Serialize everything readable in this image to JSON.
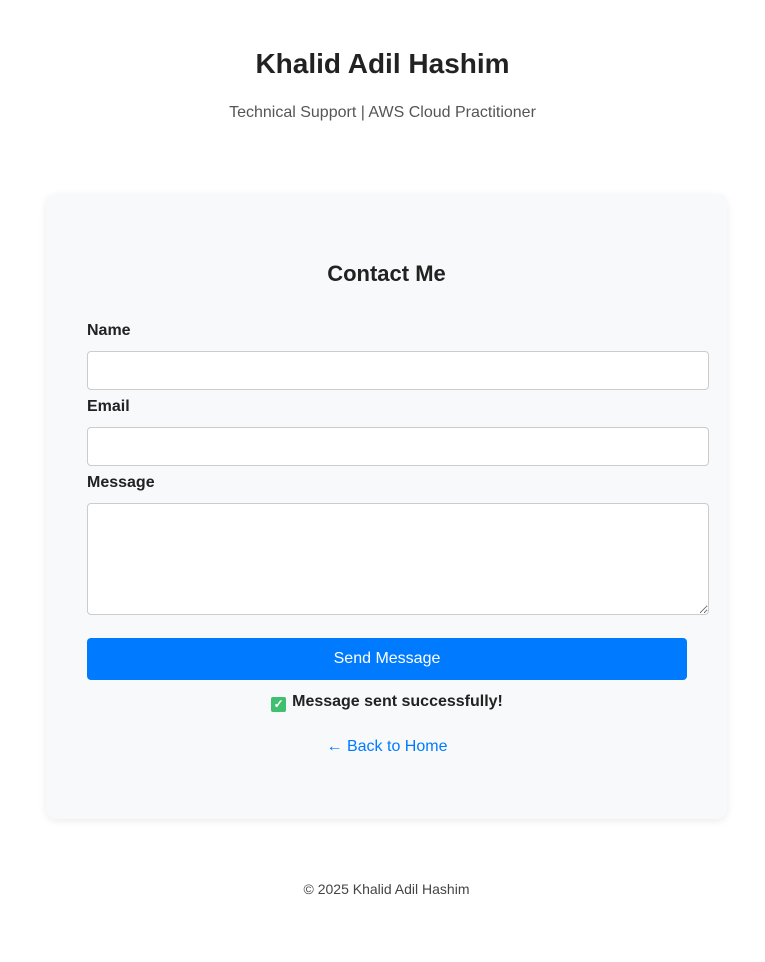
{
  "header": {
    "title": "Khalid Adil Hashim",
    "subtitle": "Technical Support | AWS Cloud Practitioner"
  },
  "contact": {
    "title": "Contact Me",
    "name_label": "Name",
    "name_value": "",
    "email_label": "Email",
    "email_value": "",
    "message_label": "Message",
    "message_value": "",
    "submit_label": "Send Message",
    "status_icon": "check-mark-button-icon",
    "status_text": "Message sent successfully!",
    "back_link": "← Back to Home"
  },
  "colors": {
    "accent": "#007bff",
    "success": "#3fbf6f"
  },
  "footer": {
    "text": "© 2025 Khalid Adil Hashim"
  }
}
